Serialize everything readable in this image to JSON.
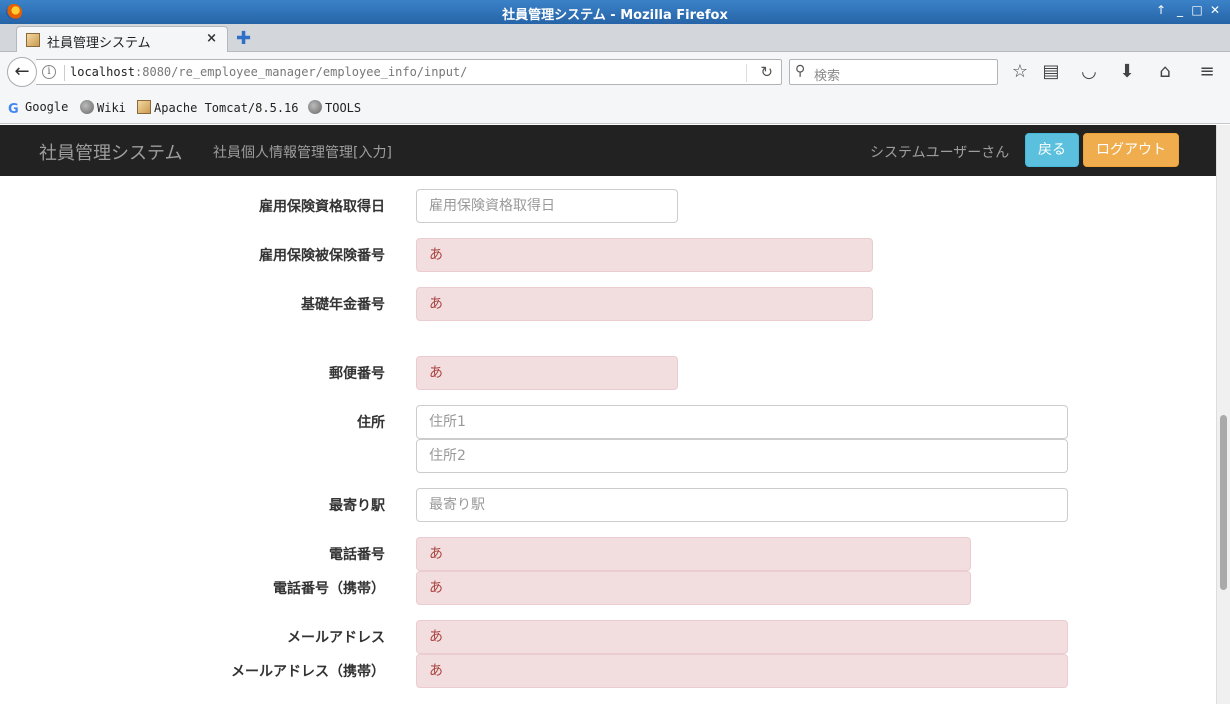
{
  "window": {
    "title": "社員管理システム - Mozilla Firefox"
  },
  "tab": {
    "label": "社員管理システム",
    "close": "×",
    "new_tab": "✚"
  },
  "navbar": {
    "url_host": "localhost",
    "url_rest": ":8080/re_employee_manager/employee_info/input/",
    "search_placeholder": "検索"
  },
  "bookmarks": [
    {
      "label": "Google"
    },
    {
      "label": "Wiki"
    },
    {
      "label": "Apache Tomcat/8.5.16"
    },
    {
      "label": "TOOLS"
    }
  ],
  "app": {
    "brand": "社員管理システム",
    "page_title": "社員個人情報管理管理[入力]",
    "user": "システムユーザーさん",
    "back_button": "戻る",
    "logout_button": "ログアウト"
  },
  "form": {
    "employment_insurance_date": {
      "label": "雇用保険資格取得日",
      "placeholder": "雇用保険資格取得日",
      "value": ""
    },
    "employment_insurance_no": {
      "label": "雇用保険被保険番号",
      "value": "あ"
    },
    "pension_no": {
      "label": "基礎年金番号",
      "value": "あ"
    },
    "postal_code": {
      "label": "郵便番号",
      "value": "あ"
    },
    "address": {
      "label": "住所",
      "placeholder1": "住所1",
      "placeholder2": "住所2"
    },
    "nearest_station": {
      "label": "最寄り駅",
      "placeholder": "最寄り駅"
    },
    "phone": {
      "label": "電話番号",
      "value": "あ"
    },
    "mobile_phone": {
      "label": "電話番号（携帯）",
      "value": "あ"
    },
    "email": {
      "label": "メールアドレス",
      "value": "あ"
    },
    "mobile_email": {
      "label": "メールアドレス（携帯）",
      "value": "あ"
    }
  },
  "colors": {
    "error_bg": "#f2dede",
    "error_text": "#a94442",
    "info_button": "#5bc0de",
    "warning_button": "#f0ad4e",
    "navbar_bg": "#222222"
  }
}
